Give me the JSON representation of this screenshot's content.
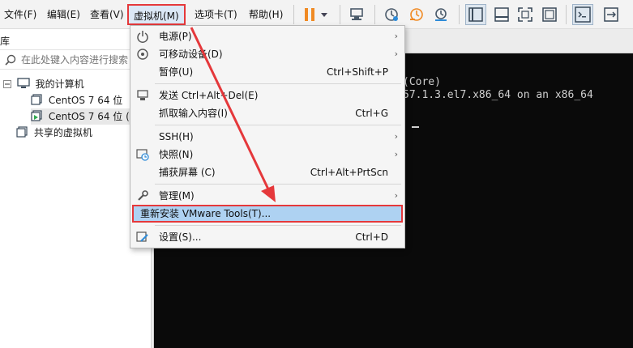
{
  "menubar": {
    "file": "文件(F)",
    "edit": "编辑(E)",
    "view": "查看(V)",
    "vm": "虚拟机(M)",
    "tabs": "选项卡(T)",
    "help": "帮助(H)"
  },
  "toolbar": {
    "icons": [
      "pause-icon",
      "dropdown-caret-icon",
      "send-ctrl-alt-del-icon",
      "snapshot-icon",
      "revert-snapshot-icon",
      "snapshot-manager-icon",
      "library-view-icon",
      "thumbnail-bar-icon",
      "fullscreen-icon",
      "unity-icon",
      "console-view-icon",
      "stretch-icon"
    ],
    "pause_color": "#f08a24"
  },
  "library": {
    "title": "库",
    "search_placeholder": "在此处键入内容进行搜索",
    "tree": {
      "root": "我的计算机",
      "vm1": "CentOS 7 64 位",
      "vm2": "CentOS 7 64 位 (2",
      "shared": "共享的虚拟机"
    }
  },
  "console": {
    "line1": "(Core)",
    "line2": "57.1.3.el7.x86_64 on an x86_64"
  },
  "vm_menu": {
    "power": "电源(P)",
    "removable": "可移动设备(D)",
    "pause": "暂停(U)",
    "pause_shortcut": "Ctrl+Shift+P",
    "send_cad": "发送 Ctrl+Alt+Del(E)",
    "grab_input": "抓取输入内容(I)",
    "grab_shortcut": "Ctrl+G",
    "ssh": "SSH(H)",
    "snapshot": "快照(N)",
    "capture": "捕获屏幕 (C)",
    "capture_shortcut": "Ctrl+Alt+PrtScn",
    "manage": "管理(M)",
    "reinstall_tools": "重新安装 VMware Tools(T)...",
    "settings": "设置(S)...",
    "settings_shortcut": "Ctrl+D"
  },
  "colors": {
    "annotation_red": "#e5383b",
    "highlight_blue": "#aed2f2",
    "console_bg": "#0a0a0a"
  }
}
